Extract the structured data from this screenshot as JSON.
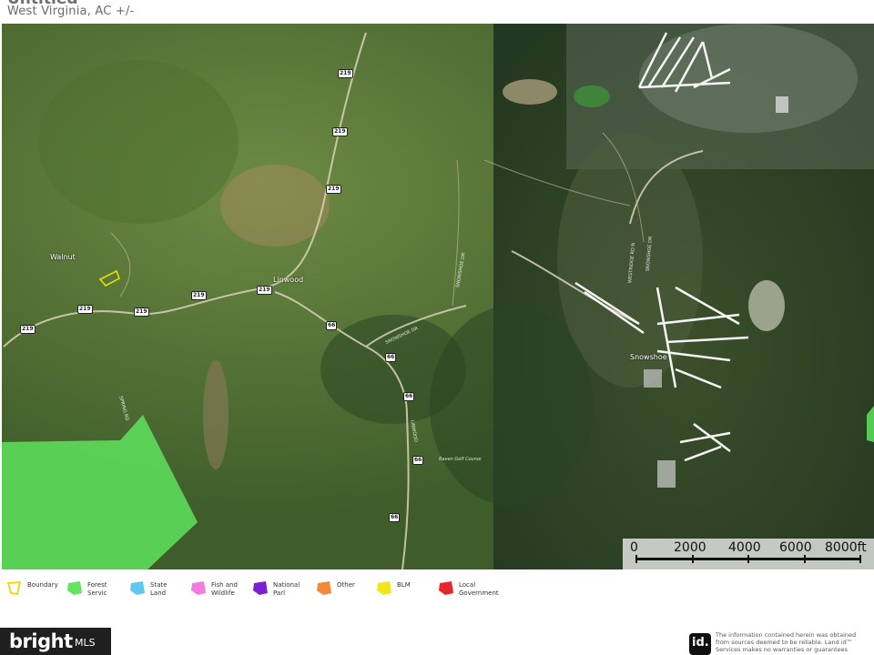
{
  "header": {
    "title": "Untitled",
    "subtitle": "West Virginia,  AC +/-"
  },
  "map": {
    "places": [
      {
        "name": "Walnut"
      },
      {
        "name": "Linwood"
      },
      {
        "name": "Snowshoe"
      }
    ],
    "road_shields": [
      "219",
      "219",
      "219",
      "219",
      "219",
      "219",
      "219",
      "219",
      "66",
      "66",
      "66",
      "66",
      "66"
    ],
    "road_labels": [
      "SNOWSHOE DR",
      "SNOWSHOE DR",
      "WESTRIDGE RD N",
      "SNOWSHOE DR",
      "LINWOOD",
      "SPRING RD",
      "Raven Golf Course"
    ],
    "colors": {
      "forest_service": "#5ee35e",
      "boundary": "#e8e000"
    }
  },
  "scalebar": {
    "labels": [
      "0",
      "2000",
      "4000",
      "6000",
      "8000ft"
    ]
  },
  "legend": {
    "items": [
      {
        "label": "Boundary",
        "color": "#e8d900",
        "icon": "boundary-outline-icon"
      },
      {
        "label": "Forest Servic",
        "color": "#63e35e",
        "icon": "forest-service-icon"
      },
      {
        "label": "State Land",
        "color": "#5fc8f0",
        "icon": "state-land-icon"
      },
      {
        "label": "Fish and Wildlife",
        "color": "#f07ee0",
        "icon": "fish-wildlife-icon"
      },
      {
        "label": "National Parl",
        "color": "#7a1fd1",
        "icon": "national-park-icon"
      },
      {
        "label": "Other",
        "color": "#f08a3a",
        "icon": "other-icon"
      },
      {
        "label": "BLM",
        "color": "#f3e51c",
        "icon": "blm-icon"
      },
      {
        "label": "Local Government",
        "color": "#e8262a",
        "icon": "local-government-icon"
      }
    ]
  },
  "footer": {
    "bright_logo": "bright",
    "bright_mls": "MLS",
    "id_logo": "id.",
    "disclaimer": "The information contained herein was obtained from sources deemed to be reliable. Land id™ Services makes no warranties or guarantees"
  }
}
